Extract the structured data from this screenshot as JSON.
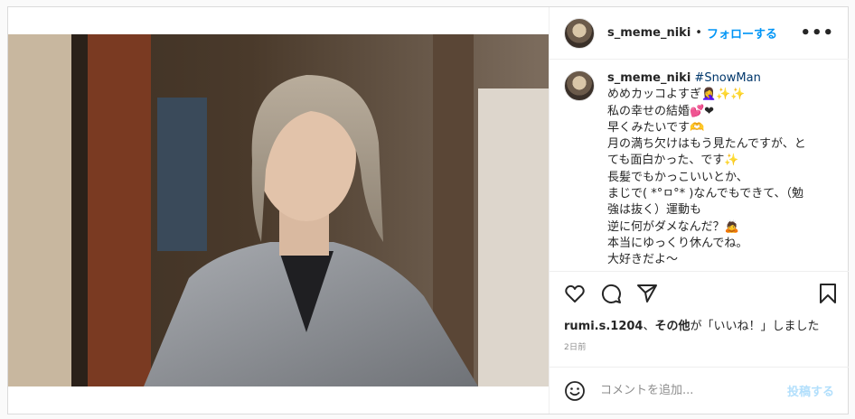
{
  "header": {
    "username": "s_meme_niki",
    "separator": "•",
    "follow_label": "フォローする",
    "more_label": "•••"
  },
  "caption": {
    "username": "s_meme_niki",
    "hashtag": "#SnowMan",
    "lines": [
      "めめカッコよすぎ🤦‍♀️✨✨",
      "私の幸せの結婚💕❤",
      "早くみたいです🫶",
      "月の満ち欠けはもう見たんですが、と",
      "ても面白かった、です✨",
      "長髪でもかっこいいとか、",
      "まじで( *°ㅁ°* )なんでもできて、（勉",
      "強は抜く）運動も",
      "逆に何がダメなんだ？🙇",
      "本当にゆっくり休んでね。",
      "大好きだよ〜"
    ]
  },
  "likes": {
    "user": "rumi.s.1204",
    "comma": "、",
    "others": "その他",
    "suffix": "が「いいね！」しました"
  },
  "time": "2日前",
  "comment": {
    "placeholder": "コメントを追加...",
    "post_label": "投稿する"
  },
  "icons": {
    "like": "heart-icon",
    "comment": "speech-bubble-icon",
    "share": "paper-plane-icon",
    "save": "bookmark-icon",
    "emoji": "smiley-icon"
  }
}
